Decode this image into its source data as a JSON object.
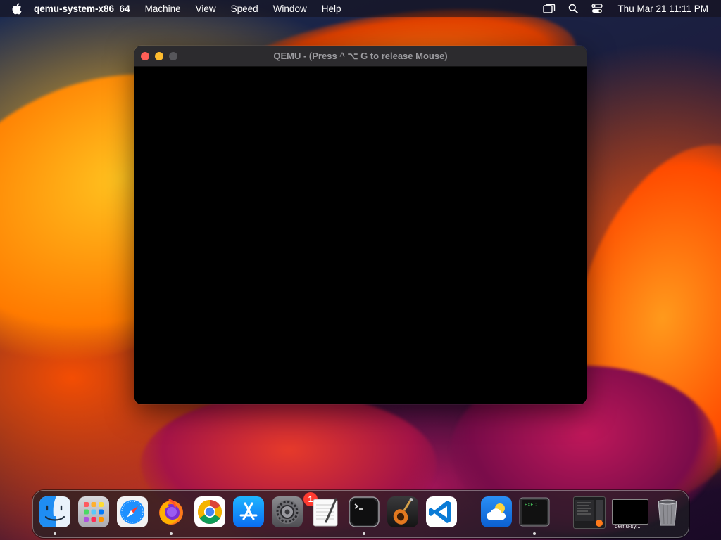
{
  "menubar": {
    "app_name": "qemu-system-x86_64",
    "items": [
      "Machine",
      "View",
      "Speed",
      "Window",
      "Help"
    ],
    "clock": "Thu Mar 21  11:11 PM",
    "status_icons": [
      "screen-mirroring-icon",
      "spotlight-search-icon",
      "control-center-icon"
    ]
  },
  "window": {
    "title": "QEMU - (Press  ^ ⌥ G  to release Mouse)"
  },
  "dock": {
    "apps": [
      "Finder",
      "Launchpad",
      "Safari",
      "Firefox",
      "Google Chrome",
      "App Store",
      "System Preferences",
      "TextEdit",
      "Terminal",
      "GarageBand",
      "Visual Studio Code",
      "Weather",
      "Console"
    ],
    "settings_badge": "1",
    "minimized_label": "qemu-sy..."
  },
  "colors": {
    "close": "#ff5f57",
    "minimize": "#febc2e",
    "zoom_disabled": "#56565a",
    "badge": "#ff3b30"
  }
}
